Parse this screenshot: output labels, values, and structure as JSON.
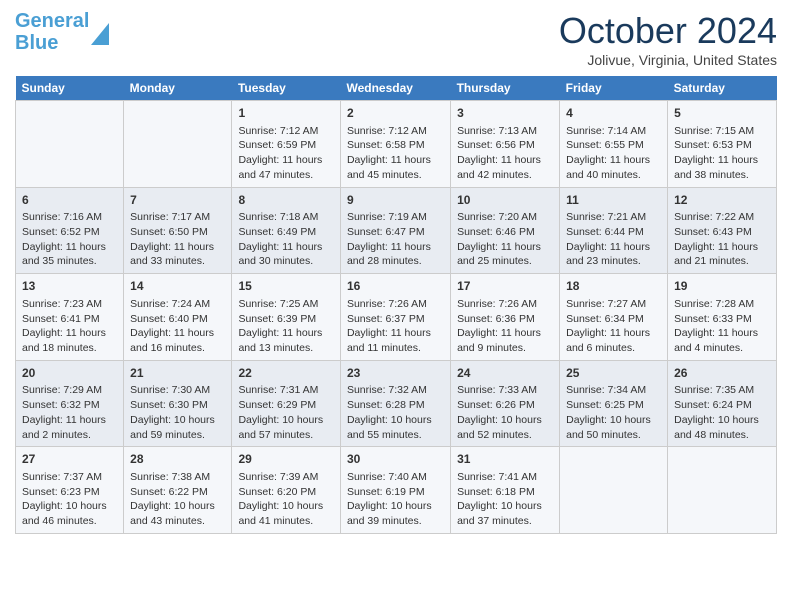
{
  "header": {
    "logo_line1": "General",
    "logo_line2": "Blue",
    "month_title": "October 2024",
    "location": "Jolivue, Virginia, United States"
  },
  "calendar": {
    "days_of_week": [
      "Sunday",
      "Monday",
      "Tuesday",
      "Wednesday",
      "Thursday",
      "Friday",
      "Saturday"
    ],
    "weeks": [
      [
        {
          "day": "",
          "content": ""
        },
        {
          "day": "",
          "content": ""
        },
        {
          "day": "1",
          "content": "Sunrise: 7:12 AM\nSunset: 6:59 PM\nDaylight: 11 hours and 47 minutes."
        },
        {
          "day": "2",
          "content": "Sunrise: 7:12 AM\nSunset: 6:58 PM\nDaylight: 11 hours and 45 minutes."
        },
        {
          "day": "3",
          "content": "Sunrise: 7:13 AM\nSunset: 6:56 PM\nDaylight: 11 hours and 42 minutes."
        },
        {
          "day": "4",
          "content": "Sunrise: 7:14 AM\nSunset: 6:55 PM\nDaylight: 11 hours and 40 minutes."
        },
        {
          "day": "5",
          "content": "Sunrise: 7:15 AM\nSunset: 6:53 PM\nDaylight: 11 hours and 38 minutes."
        }
      ],
      [
        {
          "day": "6",
          "content": "Sunrise: 7:16 AM\nSunset: 6:52 PM\nDaylight: 11 hours and 35 minutes."
        },
        {
          "day": "7",
          "content": "Sunrise: 7:17 AM\nSunset: 6:50 PM\nDaylight: 11 hours and 33 minutes."
        },
        {
          "day": "8",
          "content": "Sunrise: 7:18 AM\nSunset: 6:49 PM\nDaylight: 11 hours and 30 minutes."
        },
        {
          "day": "9",
          "content": "Sunrise: 7:19 AM\nSunset: 6:47 PM\nDaylight: 11 hours and 28 minutes."
        },
        {
          "day": "10",
          "content": "Sunrise: 7:20 AM\nSunset: 6:46 PM\nDaylight: 11 hours and 25 minutes."
        },
        {
          "day": "11",
          "content": "Sunrise: 7:21 AM\nSunset: 6:44 PM\nDaylight: 11 hours and 23 minutes."
        },
        {
          "day": "12",
          "content": "Sunrise: 7:22 AM\nSunset: 6:43 PM\nDaylight: 11 hours and 21 minutes."
        }
      ],
      [
        {
          "day": "13",
          "content": "Sunrise: 7:23 AM\nSunset: 6:41 PM\nDaylight: 11 hours and 18 minutes."
        },
        {
          "day": "14",
          "content": "Sunrise: 7:24 AM\nSunset: 6:40 PM\nDaylight: 11 hours and 16 minutes."
        },
        {
          "day": "15",
          "content": "Sunrise: 7:25 AM\nSunset: 6:39 PM\nDaylight: 11 hours and 13 minutes."
        },
        {
          "day": "16",
          "content": "Sunrise: 7:26 AM\nSunset: 6:37 PM\nDaylight: 11 hours and 11 minutes."
        },
        {
          "day": "17",
          "content": "Sunrise: 7:26 AM\nSunset: 6:36 PM\nDaylight: 11 hours and 9 minutes."
        },
        {
          "day": "18",
          "content": "Sunrise: 7:27 AM\nSunset: 6:34 PM\nDaylight: 11 hours and 6 minutes."
        },
        {
          "day": "19",
          "content": "Sunrise: 7:28 AM\nSunset: 6:33 PM\nDaylight: 11 hours and 4 minutes."
        }
      ],
      [
        {
          "day": "20",
          "content": "Sunrise: 7:29 AM\nSunset: 6:32 PM\nDaylight: 11 hours and 2 minutes."
        },
        {
          "day": "21",
          "content": "Sunrise: 7:30 AM\nSunset: 6:30 PM\nDaylight: 10 hours and 59 minutes."
        },
        {
          "day": "22",
          "content": "Sunrise: 7:31 AM\nSunset: 6:29 PM\nDaylight: 10 hours and 57 minutes."
        },
        {
          "day": "23",
          "content": "Sunrise: 7:32 AM\nSunset: 6:28 PM\nDaylight: 10 hours and 55 minutes."
        },
        {
          "day": "24",
          "content": "Sunrise: 7:33 AM\nSunset: 6:26 PM\nDaylight: 10 hours and 52 minutes."
        },
        {
          "day": "25",
          "content": "Sunrise: 7:34 AM\nSunset: 6:25 PM\nDaylight: 10 hours and 50 minutes."
        },
        {
          "day": "26",
          "content": "Sunrise: 7:35 AM\nSunset: 6:24 PM\nDaylight: 10 hours and 48 minutes."
        }
      ],
      [
        {
          "day": "27",
          "content": "Sunrise: 7:37 AM\nSunset: 6:23 PM\nDaylight: 10 hours and 46 minutes."
        },
        {
          "day": "28",
          "content": "Sunrise: 7:38 AM\nSunset: 6:22 PM\nDaylight: 10 hours and 43 minutes."
        },
        {
          "day": "29",
          "content": "Sunrise: 7:39 AM\nSunset: 6:20 PM\nDaylight: 10 hours and 41 minutes."
        },
        {
          "day": "30",
          "content": "Sunrise: 7:40 AM\nSunset: 6:19 PM\nDaylight: 10 hours and 39 minutes."
        },
        {
          "day": "31",
          "content": "Sunrise: 7:41 AM\nSunset: 6:18 PM\nDaylight: 10 hours and 37 minutes."
        },
        {
          "day": "",
          "content": ""
        },
        {
          "day": "",
          "content": ""
        }
      ]
    ]
  }
}
